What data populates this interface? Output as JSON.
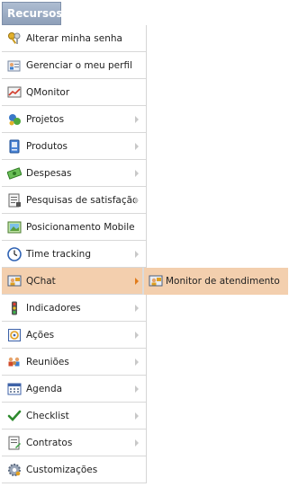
{
  "header": {
    "title": "Recursos"
  },
  "menu": [
    {
      "label": "Alterar minha senha",
      "icon": "keys-icon",
      "has_submenu": false
    },
    {
      "label": "Gerenciar o meu perfil",
      "icon": "profile-icon",
      "has_submenu": false
    },
    {
      "label": "QMonitor",
      "icon": "monitor-chart-icon",
      "has_submenu": false
    },
    {
      "label": "Projetos",
      "icon": "projects-icon",
      "has_submenu": true
    },
    {
      "label": "Produtos",
      "icon": "products-icon",
      "has_submenu": true
    },
    {
      "label": "Despesas",
      "icon": "money-icon",
      "has_submenu": true
    },
    {
      "label": "Pesquisas de satisfação",
      "icon": "survey-icon",
      "has_submenu": true
    },
    {
      "label": "Posicionamento Mobile",
      "icon": "mobile-position-icon",
      "has_submenu": false
    },
    {
      "label": "Time tracking",
      "icon": "clock-icon",
      "has_submenu": true
    },
    {
      "label": "QChat",
      "icon": "chat-icon",
      "has_submenu": true,
      "active": true
    },
    {
      "label": "Indicadores",
      "icon": "traffic-light-icon",
      "has_submenu": true
    },
    {
      "label": "Ações",
      "icon": "actions-icon",
      "has_submenu": true
    },
    {
      "label": "Reuniões",
      "icon": "meeting-icon",
      "has_submenu": true
    },
    {
      "label": "Agenda",
      "icon": "calendar-icon",
      "has_submenu": true
    },
    {
      "label": "Checklist",
      "icon": "checklist-icon",
      "has_submenu": true
    },
    {
      "label": "Contratos",
      "icon": "contract-icon",
      "has_submenu": true
    },
    {
      "label": "Customizações",
      "icon": "gear-icon",
      "has_submenu": false
    }
  ],
  "submenu": {
    "parent": "QChat",
    "items": [
      {
        "label": "Monitor de atendimento",
        "icon": "chat-icon"
      }
    ]
  },
  "colors": {
    "header_bg": "#98a9c1",
    "active_bg": "#f3cfae",
    "border": "#d8d8d8",
    "chevron": "#c8c8c8"
  }
}
